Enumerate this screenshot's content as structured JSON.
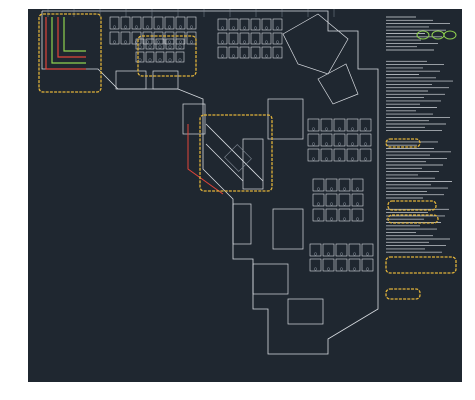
{
  "drawing": {
    "background": "#1f2730",
    "linework_color": "#d9dde2",
    "dim_line_color": "#7f8893",
    "cloud_color": "#e0b23a",
    "highlight_green": "#8fd14f",
    "red_markup": "#e0443a",
    "notes_blocks": [
      {
        "name": "general-notes",
        "lines": 11
      },
      {
        "name": "plan-notes",
        "lines": 22
      },
      {
        "name": "keynotes",
        "lines": 18
      },
      {
        "name": "revision-notes",
        "lines": 14
      }
    ],
    "clouds": [
      {
        "name": "cloud-stair-riser"
      },
      {
        "name": "cloud-workstations"
      },
      {
        "name": "cloud-core-room"
      },
      {
        "name": "cloud-note-1"
      },
      {
        "name": "cloud-note-2"
      },
      {
        "name": "cloud-note-3"
      },
      {
        "name": "cloud-note-4"
      },
      {
        "name": "cloud-note-5"
      }
    ]
  }
}
